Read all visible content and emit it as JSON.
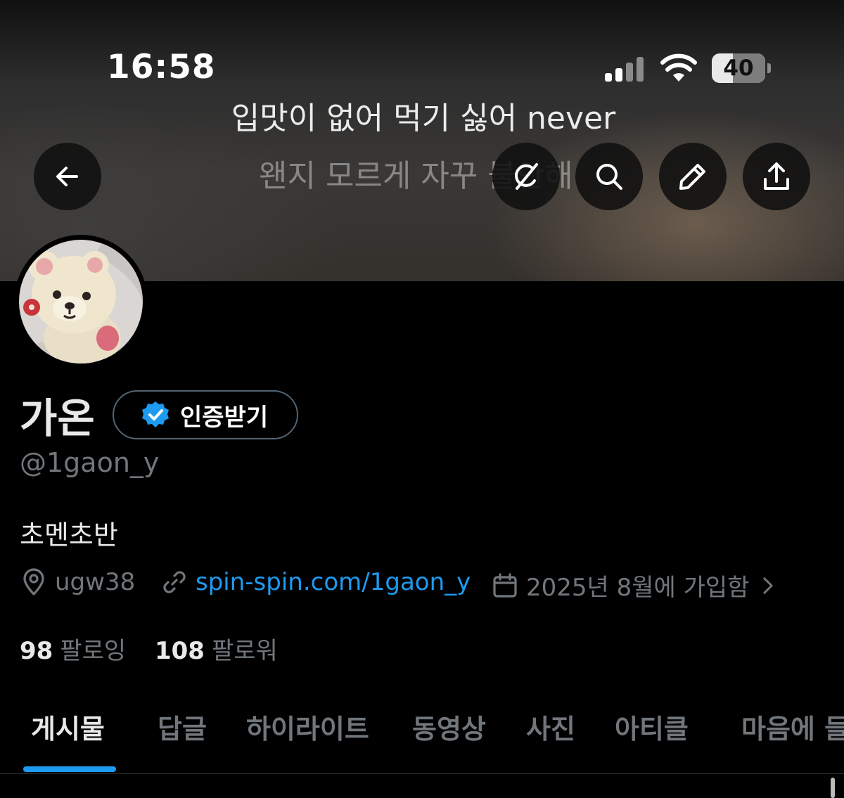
{
  "status_bar": {
    "time": "16:58",
    "battery_level": "40",
    "battery_fraction": 0.4,
    "signal_bars_active": 2,
    "signal_bars_total": 4
  },
  "header": {
    "lyric_line_1": "입맛이 없어 먹기 싫어 never",
    "lyric_line_2": "왠지 모르게 자꾸 불안해",
    "back_icon": "arrow-left-icon",
    "actions": [
      "grok-icon",
      "search-icon",
      "pencil-icon",
      "share-icon"
    ]
  },
  "profile": {
    "display_name": "가온",
    "verify_label": "인증받기",
    "handle": "@1gaon_y",
    "bio": "초멘초반",
    "location": "ugw38",
    "website": "spin-spin.com/1gaon_y",
    "joined": "2025년 8월에 가입함",
    "following_count": "98",
    "following_label": "팔로잉",
    "followers_count": "108",
    "followers_label": "팔로워"
  },
  "tabs": [
    {
      "label": "게시물",
      "active": true
    },
    {
      "label": "답글",
      "active": false
    },
    {
      "label": "하이라이트",
      "active": false
    },
    {
      "label": "동영상",
      "active": false
    },
    {
      "label": "사진",
      "active": false
    },
    {
      "label": "아티클",
      "active": false
    },
    {
      "label": "마음에 들어요",
      "active": false
    }
  ],
  "colors": {
    "accent": "#1d9bf0",
    "background": "#000000",
    "text_primary": "#e7e9ea",
    "text_secondary": "#71767b"
  }
}
